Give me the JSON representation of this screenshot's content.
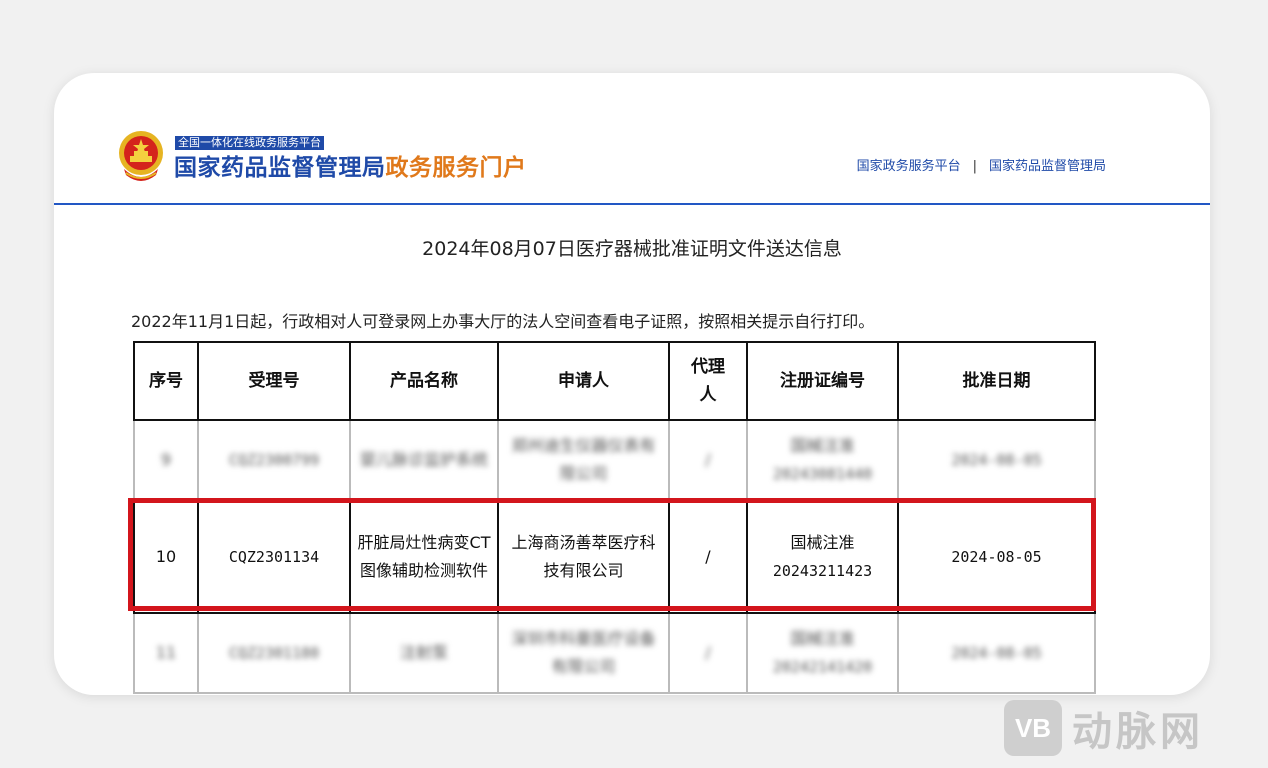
{
  "header": {
    "tagline": "全国一体化在线政务服务平台",
    "title_part1": "国家药品监督管理局",
    "title_part2": "政务服务门户",
    "links": [
      "国家政务服务平台",
      "国家药品监督管理局"
    ],
    "separator": "|"
  },
  "document": {
    "title": "2024年08月07日医疗器械批准证明文件送达信息",
    "notice": "2022年11月1日起，行政相对人可登录网上办事大厅的法人空间查看电子证照，按照相关提示自行打印。"
  },
  "table": {
    "headers": [
      "序号",
      "受理号",
      "产品名称",
      "申请人",
      "代理人",
      "注册证编号",
      "批准日期"
    ],
    "rows": [
      {
        "no": "9",
        "acceptance": "CQZ2300799",
        "product": "婴儿脉诊监护系统",
        "applicant": "郑州迪生仪器仪表有限公司",
        "agent": "/",
        "reg_no_line1": "国械注准",
        "reg_no_line2": "20243081440",
        "date": "2024-08-05"
      },
      {
        "no": "10",
        "acceptance": "CQZ2301134",
        "product": "肝脏局灶性病变CT图像辅助检测软件",
        "applicant": "上海商汤善萃医疗科技有限公司",
        "agent": "/",
        "reg_no_line1": "国械注准",
        "reg_no_line2": "20243211423",
        "date": "2024-08-05"
      },
      {
        "no": "11",
        "acceptance": "CQZ2301180",
        "product": "注射泵",
        "applicant": "深圳市科曼医疗设备有限公司",
        "agent": "/",
        "reg_no_line1": "国械注准",
        "reg_no_line2": "20242141420",
        "date": "2024-08-05"
      }
    ]
  },
  "watermark": {
    "logo": "VB",
    "text": "动脉网"
  },
  "colors": {
    "brand_blue": "#1f4aa8",
    "brand_orange": "#e0791b",
    "highlight_red": "#d3151c"
  }
}
